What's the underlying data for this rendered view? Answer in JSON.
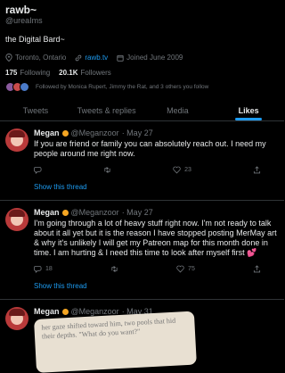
{
  "profile": {
    "name": "rawb~",
    "handle": "@ureaIms",
    "bio": "the Digital Bard~",
    "location": "Toronto, Ontario",
    "website": "rawb.tv",
    "joined": "Joined June 2009",
    "following_count": "175",
    "following_label": "Following",
    "followers_count": "20.1K",
    "followers_label": "Followers",
    "followed_by": "Followed by Monica Rupert, Jimmy the Rat, and 3 others you follow"
  },
  "tabs": [
    {
      "label": "Tweets"
    },
    {
      "label": "Tweets & replies"
    },
    {
      "label": "Media"
    },
    {
      "label": "Likes"
    }
  ],
  "tweets": [
    {
      "name": "Megan",
      "handle": "@Meganzoor",
      "date": "· May 27",
      "text": "If you are friend or family you can absolutely reach out. I need my people around me right now.",
      "likes": "23",
      "show_thread": "Show this thread"
    },
    {
      "name": "Megan",
      "handle": "@Meganzoor",
      "date": "· May 27",
      "text": "I'm going through a lot of heavy stuff right now. I'm not ready to talk about it all yet but it is the reason I have stopped posting MerMay art & why it's unlikely I will get my Patreon map for this month done in time. I am hurting & I need this time to look after myself first 💕",
      "replies": "18",
      "likes": "75",
      "show_thread": "Show this thread"
    },
    {
      "name": "Megan",
      "handle": "@Meganzoor",
      "date": "· May 31",
      "media_text": "her gaze shifted toward him, two pools that hid their depths. \"What do you want?\""
    }
  ],
  "colors": {
    "accent": "#1d9bf0",
    "background": "#000000",
    "muted": "#71767b"
  }
}
